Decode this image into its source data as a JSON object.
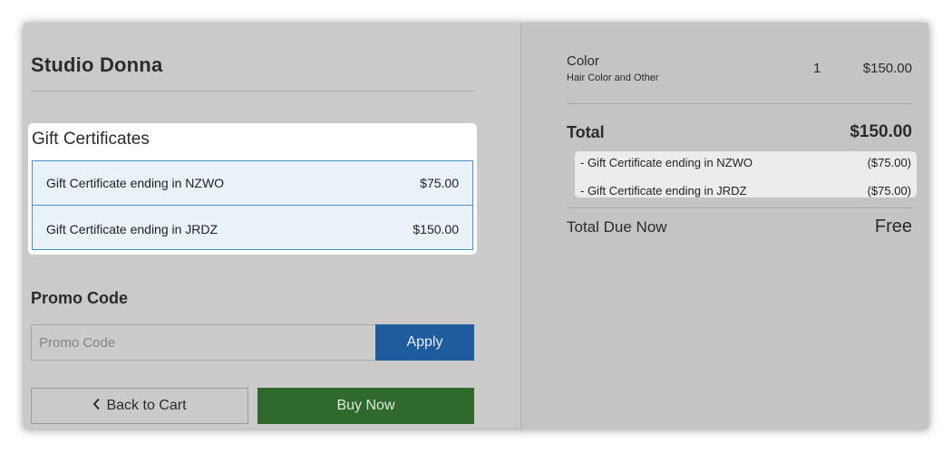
{
  "store": {
    "title": "Studio Donna"
  },
  "gift_certificates": {
    "heading": "Gift Certificates",
    "items": [
      {
        "label": "Gift Certificate ending in NZWO",
        "amount": "$75.00"
      },
      {
        "label": "Gift Certificate ending in JRDZ",
        "amount": "$150.00"
      }
    ]
  },
  "promo": {
    "heading": "Promo Code",
    "placeholder": "Promo Code",
    "value": "",
    "apply_label": "Apply"
  },
  "actions": {
    "back_label": "Back to Cart",
    "back_icon": "chevron-left-icon",
    "buy_label": "Buy Now"
  },
  "summary": {
    "item": {
      "name": "Color",
      "subtitle": "Hair Color and Other",
      "qty": "1",
      "price": "$150.00"
    },
    "total_label": "Total",
    "total_value": "$150.00",
    "applied_certificates": [
      {
        "label": "- Gift Certificate ending in NZWO",
        "amount": "($75.00)"
      },
      {
        "label": "- Gift Certificate ending in JRDZ",
        "amount": "($75.00)"
      }
    ],
    "due_label": "Total Due Now",
    "due_value": "Free"
  },
  "colors": {
    "apply_button": "#1f5c9e",
    "buy_button": "#2f6a2c",
    "certificate_border": "#4a90c8",
    "certificate_background": "#e8f2f8"
  }
}
